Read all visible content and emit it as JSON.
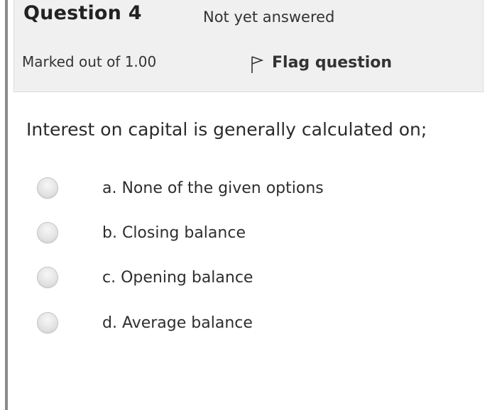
{
  "question": {
    "title": "Question 4",
    "state": "Not yet answered",
    "grade": "Marked out of 1.00",
    "flag_label": "Flag question",
    "text": "Interest on capital is generally calculated on;"
  },
  "answers": [
    {
      "label": "a. None of the given options",
      "selected": false
    },
    {
      "label": "b. Closing balance",
      "selected": false
    },
    {
      "label": "c. Opening balance",
      "selected": false
    },
    {
      "label": "d. Average balance",
      "selected": false
    }
  ],
  "colors": {
    "info_background": "#f0f0f0",
    "left_rule": "#8a8a8a",
    "text": "#333333"
  },
  "icons": {
    "flag": "flag-outline-icon",
    "radio": "radio-unselected"
  }
}
